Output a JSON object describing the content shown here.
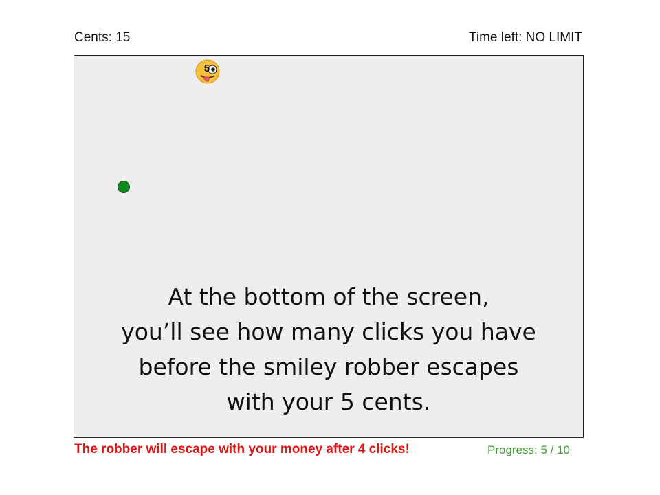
{
  "header": {
    "cents": "Cents: 15",
    "time_left": "Time left: NO LIMIT"
  },
  "game": {
    "robber": {
      "icon": "smiley-robber-icon",
      "amount_label": "5"
    },
    "target_icon": "green-dot",
    "caption_lines": [
      "At the bottom of the screen,",
      "you’ll see how many clicks you have",
      "before the smiley robber escapes",
      "with your 5 cents."
    ]
  },
  "footer": {
    "warning": "The robber will escape with your money after 4 clicks!",
    "progress": "Progress: 5 / 10"
  },
  "colors": {
    "warning": "#e21313",
    "progress": "#3d9b2e",
    "dot": "#138a1c",
    "game_background": "#eeeef0"
  }
}
